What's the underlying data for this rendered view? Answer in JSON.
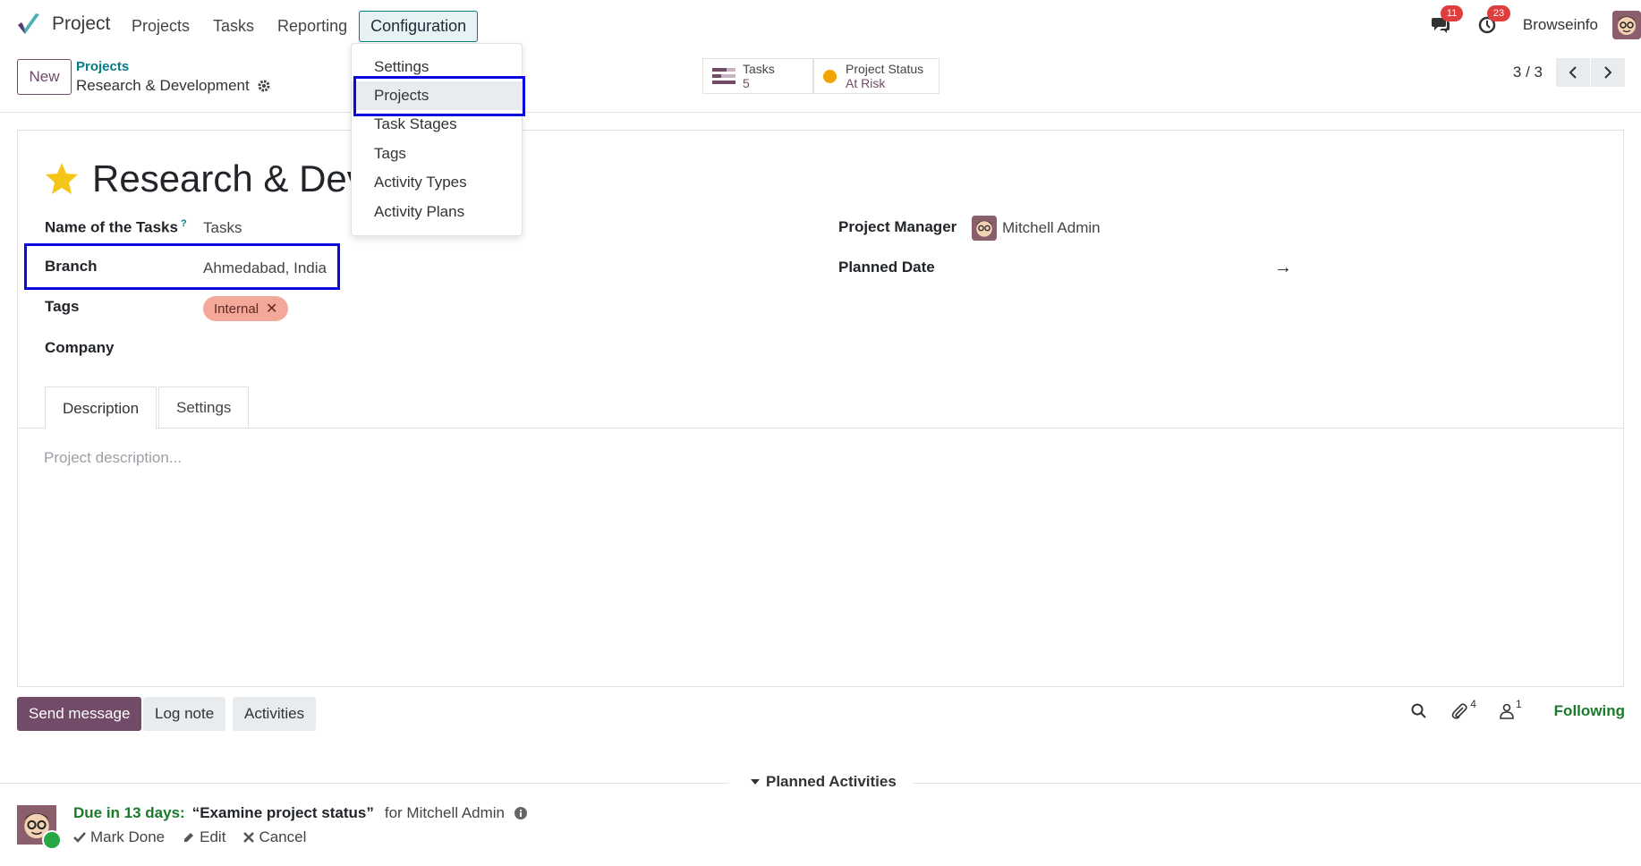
{
  "nav": {
    "app_name": "Project",
    "menu": [
      "Projects",
      "Tasks",
      "Reporting",
      "Configuration"
    ],
    "messages_count": "11",
    "activities_count": "23",
    "user_name": "Browseinfo"
  },
  "dropdown": {
    "items": [
      "Settings",
      "Projects",
      "Task Stages",
      "Tags",
      "Activity Types",
      "Activity Plans"
    ],
    "highlighted": "Projects"
  },
  "control": {
    "new_label": "New",
    "breadcrumb_parent": "Projects",
    "breadcrumb_current": "Research & Development",
    "smart_tasks_label": "Tasks",
    "smart_tasks_value": "5",
    "smart_status_label": "Project Status",
    "smart_status_value": "At Risk",
    "pager": "3 / 3"
  },
  "form": {
    "title": "Research & Deve",
    "name_of_tasks_label": "Name of the Tasks",
    "name_of_tasks_help": "?",
    "name_of_tasks_value": "Tasks",
    "branch_label": "Branch",
    "branch_value": "Ahmedabad, India",
    "tags_label": "Tags",
    "tag_value": "Internal",
    "company_label": "Company",
    "manager_label": "Project Manager",
    "manager_value": "Mitchell Admin",
    "planned_date_label": "Planned Date",
    "planned_date_arrow": "→",
    "tabs": [
      "Description",
      "Settings"
    ],
    "description_placeholder": "Project description..."
  },
  "chatter": {
    "send_message": "Send message",
    "log_note": "Log note",
    "activities": "Activities",
    "attachments_count": "4",
    "followers_count": "1",
    "following": "Following",
    "planned_activities": "Planned Activities",
    "due": "Due in 13 days:",
    "summary": "“Examine project status”",
    "assigned": "for Mitchell Admin",
    "mark_done": "Mark Done",
    "edit": "Edit",
    "cancel": "Cancel"
  },
  "colors": {
    "primary": "#714b67",
    "teal": "#017e84",
    "highlight_box": "#0a0ade",
    "tag_bg": "#f4a89a",
    "star": "#f5c518",
    "status_dot": "#f0a500",
    "due_green": "#1b7a2a"
  },
  "icons": [
    "project-logo-icon",
    "chat-icon",
    "clock-icon",
    "gear-icon",
    "chevron-left-icon",
    "chevron-right-icon",
    "star-icon",
    "search-icon",
    "paperclip-icon",
    "user-icon",
    "check-icon",
    "pencil-icon",
    "times-icon",
    "info-icon",
    "caret-down-icon"
  ]
}
